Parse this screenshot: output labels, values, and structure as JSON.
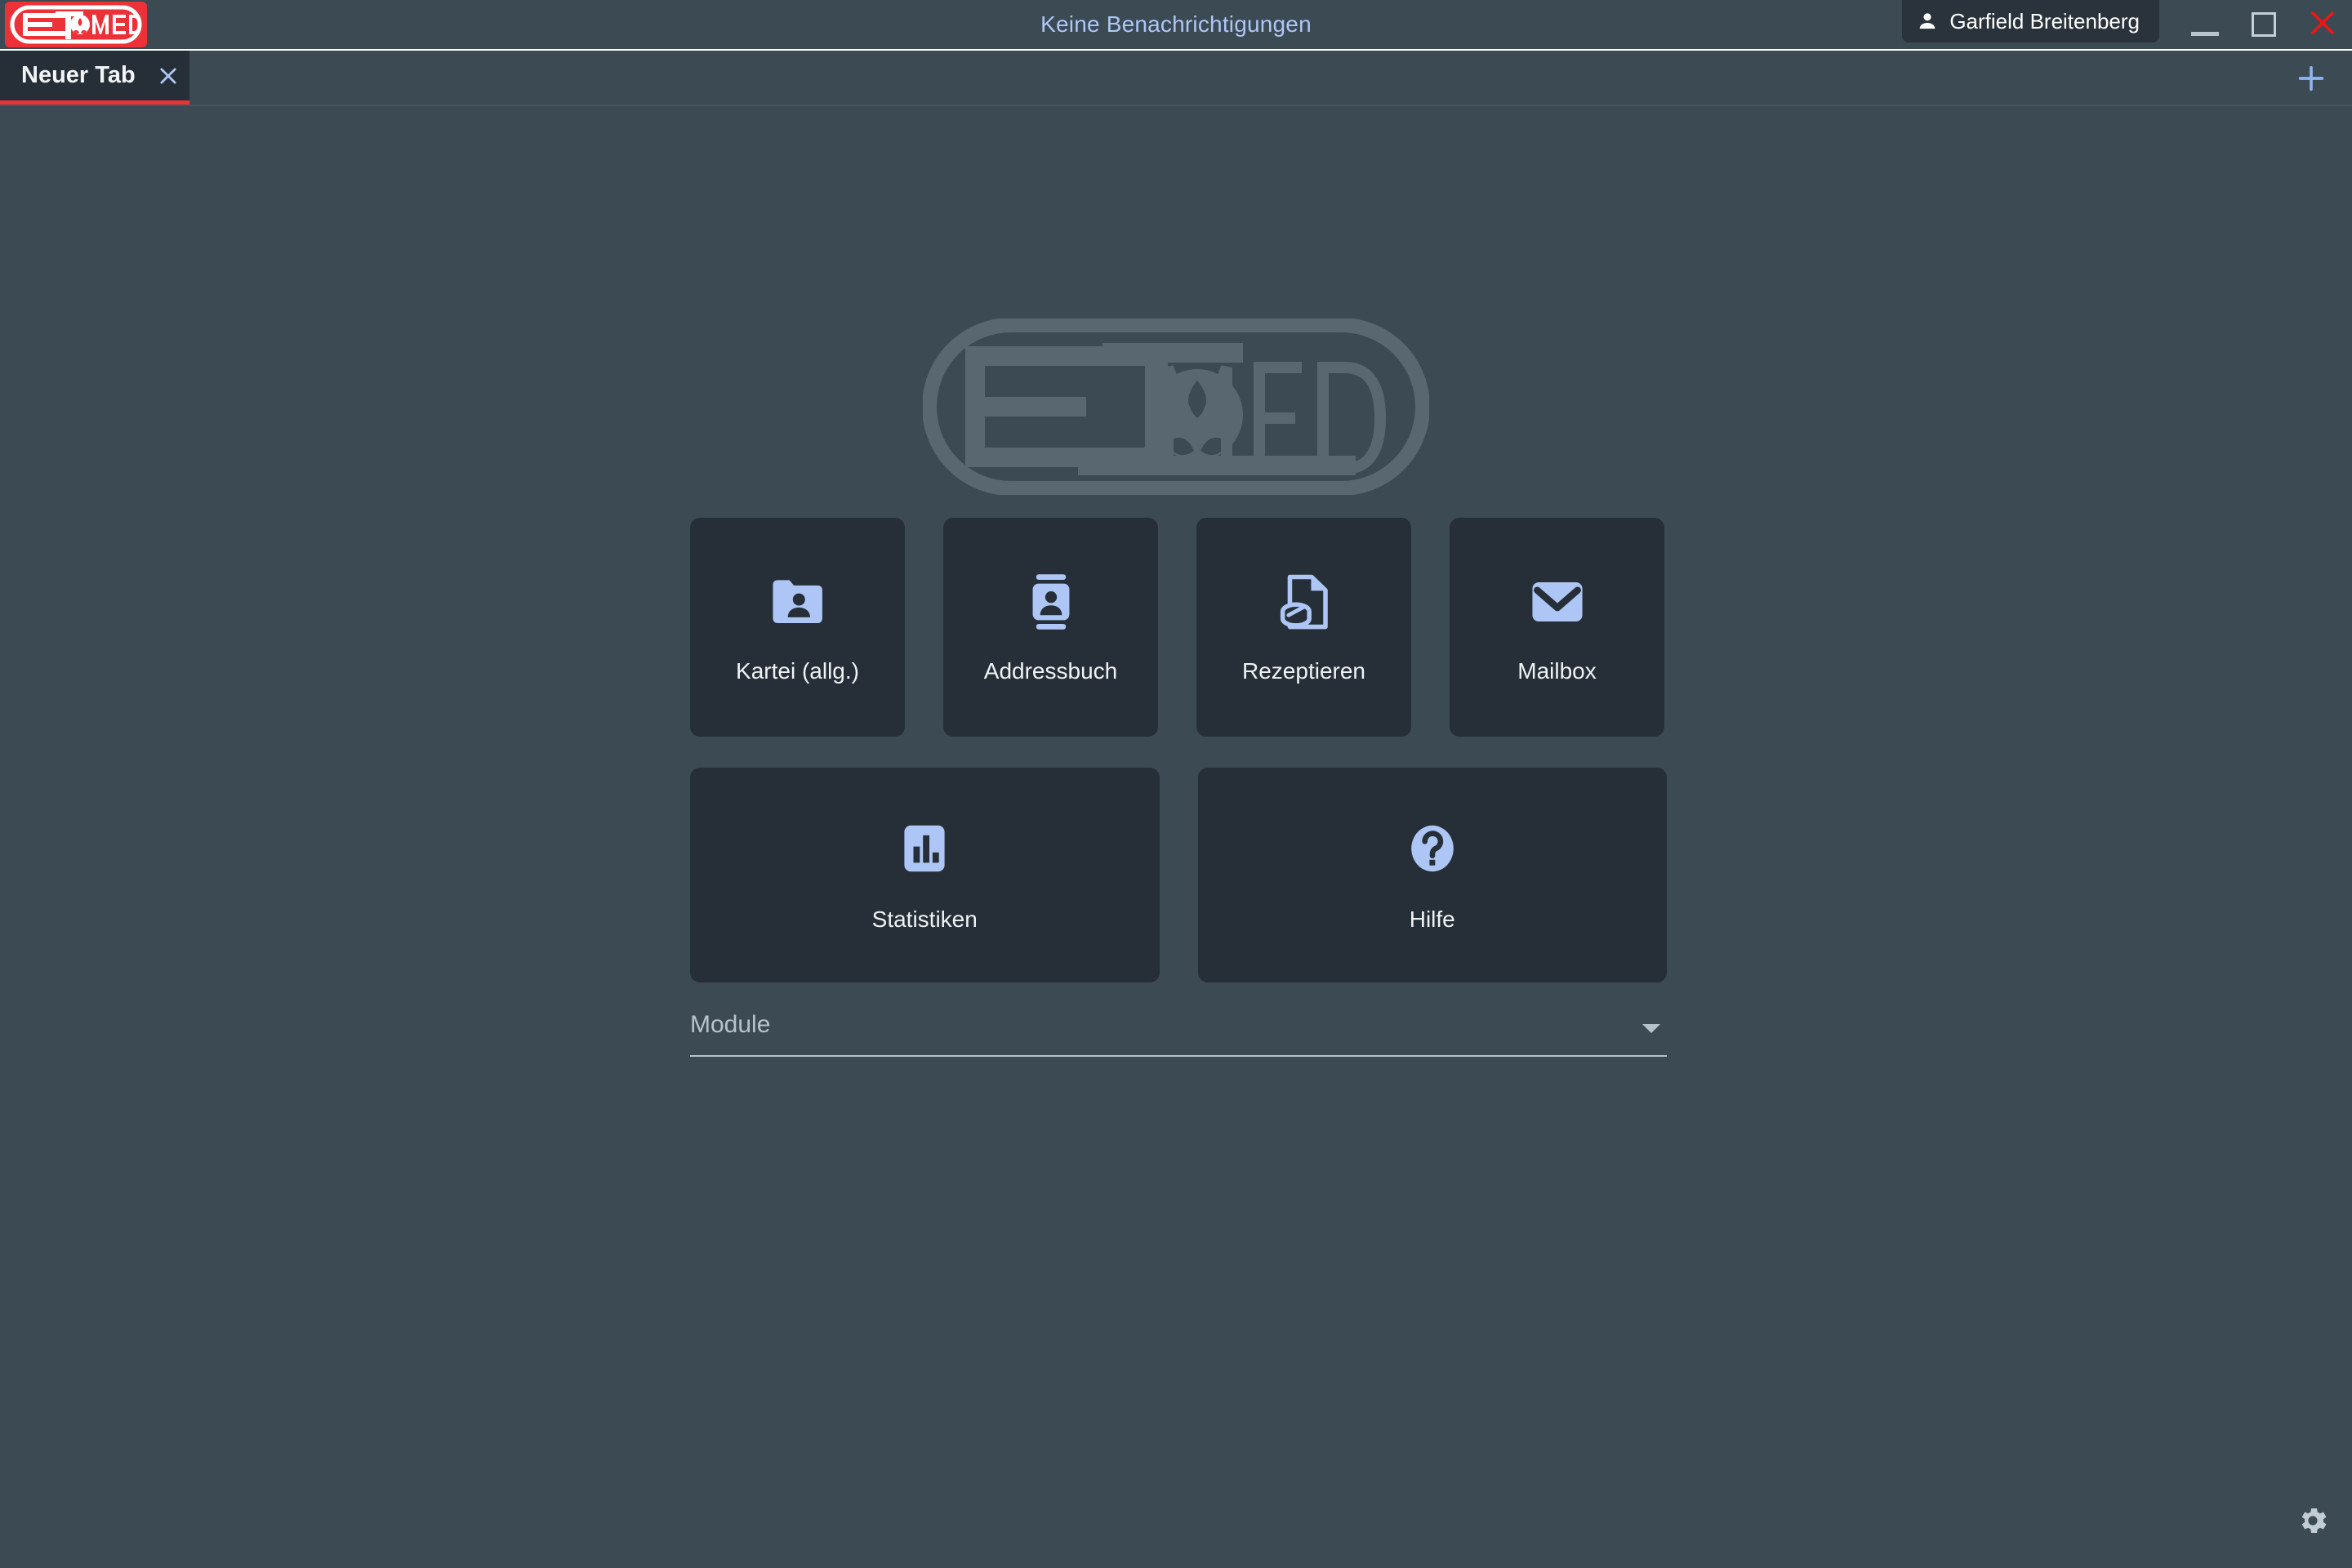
{
  "app": {
    "brand_name": "ETMED",
    "accent_red": "#ed3237",
    "accent_blue": "#aec6f5",
    "background": "#3c4a54",
    "tile_background": "#262f37"
  },
  "titlebar": {
    "notification_text": "Keine Benachrichtigungen",
    "user_name": "Garfield Breitenberg",
    "user_icon": "person-icon",
    "window_controls": [
      {
        "name": "minimize",
        "label": "—"
      },
      {
        "name": "maximize",
        "label": "▢"
      },
      {
        "name": "close",
        "label": "✕"
      }
    ]
  },
  "tabbar": {
    "tabs": [
      {
        "label": "Neuer Tab",
        "active": true,
        "close_icon": "close-icon"
      }
    ],
    "new_tab_icon": "plus-icon"
  },
  "main": {
    "watermark": "ETMED",
    "tiles_row1": [
      {
        "label": "Kartei (allg.)",
        "icon": "folder-person-icon"
      },
      {
        "label": "Addressbuch",
        "icon": "contact-card-icon"
      },
      {
        "label": "Rezeptieren",
        "icon": "prescription-pill-icon"
      },
      {
        "label": "Mailbox",
        "icon": "envelope-icon"
      }
    ],
    "tiles_row2": [
      {
        "label": "Statistiken",
        "icon": "bar-chart-icon"
      },
      {
        "label": "Hilfe",
        "icon": "question-mark-icon"
      }
    ],
    "module_select": {
      "label": "Module",
      "value": "",
      "placeholder": "Module",
      "caret_icon": "chevron-down-icon"
    }
  },
  "footer": {
    "settings_icon": "gear-icon"
  }
}
